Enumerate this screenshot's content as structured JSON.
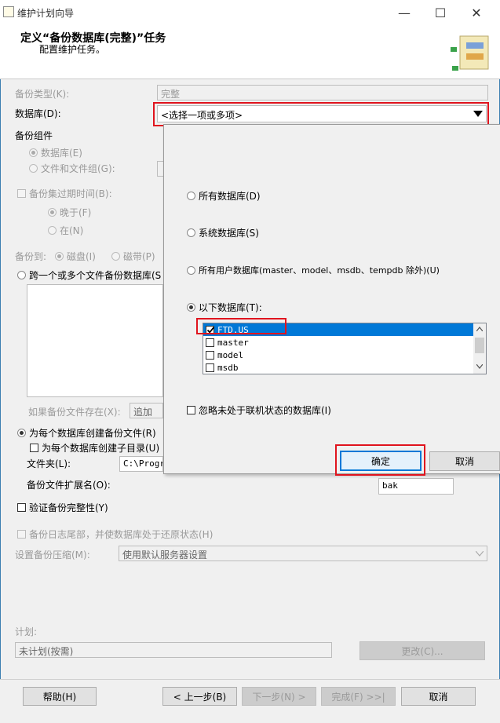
{
  "window": {
    "title": "维护计划向导",
    "minimize": "—",
    "maximize": "☐",
    "close": "✕"
  },
  "header": {
    "title": "定义“备份数据库(完整)”任务",
    "subtitle": "配置维护任务。"
  },
  "form": {
    "backup_type_label": "备份类型(K):",
    "backup_type_value": "完整",
    "database_label": "数据库(D):",
    "database_value": "<选择一项或多项>",
    "backup_component_label": "备份组件",
    "radio_database": "数据库(E)",
    "radio_files": "文件和文件组(G):",
    "expire_label": "备份集过期时间(B):",
    "radio_later": "晚于(F)",
    "radio_on": "在(N)",
    "backup_to_label": "备份到:",
    "radio_disk": "磁盘(I)",
    "radio_tape": "磁带(P)",
    "radio_span": "跨一个或多个文件备份数据库(S",
    "if_exists_label": "如果备份文件存在(X):",
    "if_exists_value": "追加",
    "radio_per_db": "为每个数据库创建备份文件(R)",
    "chk_subdir": "为每个数据库创建子目录(U)",
    "folder_label": "文件夹(L):",
    "folder_value": "C:\\Progra",
    "ext_label": "备份文件扩展名(O):",
    "ext_value": "bak",
    "chk_verify": "验证备份完整性(Y)",
    "chk_tail": "备份日志尾部，并使数据库处于还原状态(H)",
    "compression_label": "设置备份压缩(M):",
    "compression_value": "使用默认服务器设置",
    "schedule_label": "计划:",
    "schedule_value": "未计划(按需)",
    "change_button": "更改(C)..."
  },
  "popup": {
    "radio_all": "所有数据库(D)",
    "radio_system": "系统数据库(S)",
    "radio_user": "所有用户数据库(master、model、msdb、tempdb 除外)(U)",
    "radio_these": "以下数据库(T):",
    "databases": [
      {
        "name": "FTD.US",
        "checked": true,
        "selected": true
      },
      {
        "name": "master",
        "checked": false,
        "selected": false
      },
      {
        "name": "model",
        "checked": false,
        "selected": false
      },
      {
        "name": "msdb",
        "checked": false,
        "selected": false
      }
    ],
    "chk_ignore_offline": "忽略未处于联机状态的数据库(I)",
    "ok_button": "确定",
    "cancel_button": "取消"
  },
  "footer": {
    "help_button": "帮助(H)",
    "back_button": "< 上一步(B)",
    "next_button": "下一步(N) >",
    "finish_button": "完成(F) >>|",
    "cancel_button": "取消"
  },
  "colors": {
    "highlight": "#e0141e",
    "selection": "#0078d7"
  }
}
